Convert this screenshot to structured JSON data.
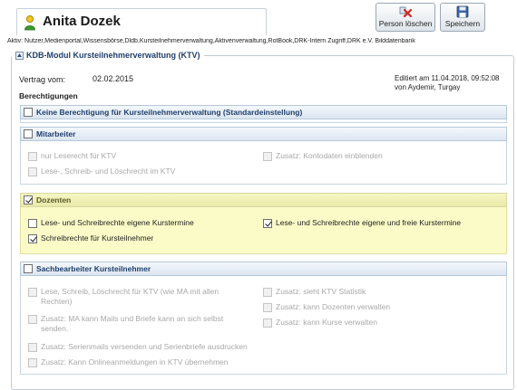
{
  "header": {
    "person_name": "Anita Dozek",
    "person_icon": "person-icon",
    "delete_label": "Person löschen",
    "save_label": "Speichern",
    "active_line": "Aktiv: Nutzer,Medienportal,Wissensbörse,Dldb,Kursteilnehmerverwaltung,Aktivenverwaltung,RotBook,DRK-Intern Zugriff,DRK e.V. Bilddatenbank"
  },
  "module": {
    "title": "KDB-Modul Kursteilnehmerverwaltung (KTV)",
    "contract_label": "Vertrag vom:",
    "contract_date": "02.02.2015",
    "edited_line1": "Editiert am 11.04.2018, 09:52:08",
    "edited_line2": "von Aydemir, Turgay",
    "permissions_heading": "Berechtigungen"
  },
  "groups": {
    "none": {
      "title": "Keine Berechtigung für Kursteilnehmerverwaltung (Standardeinstellung)",
      "checked": false
    },
    "mitarbeiter": {
      "title": "Mitarbeiter",
      "checked": false,
      "options": [
        "nur Leserecht für KTV",
        "Lese-, Schreib- und Löschrecht im KTV",
        "Zusatz: Kontodaten einblenden"
      ]
    },
    "dozenten": {
      "title": "Dozenten",
      "checked": true,
      "options": [
        "Lese- und Schreibrechte eigene Kurstermine",
        "Schreibrechte für Kursteilnehmer",
        "Lese- und Schreibrechte eigene und freie Kurstermine"
      ]
    },
    "sachbearbeiter": {
      "title": "Sachbearbeiter Kursteilnehmer",
      "checked": false,
      "options": [
        "Lese, Schreib, Löschrecht für KTV (wie MA mit allen",
        "Rechten)",
        "Zusatz: MA kann Mails und Briefe kann an sich selbst",
        "senden.",
        "Zusatz: Serienmails versenden und Serienbriefe ausdrucken",
        "Zusatz: Kann Onlineanmeldungen in KTV übernehmen",
        "Zusatz: sieht KTV Statistik",
        "Zusatz: kann Dozenten verwalten",
        "Zusatz: kann Kurse verwalten"
      ]
    }
  },
  "colors": {
    "accent": "#1f3f6b",
    "highlight": "#fbfbc6",
    "header_gradient_end": "#dbe6f1"
  }
}
